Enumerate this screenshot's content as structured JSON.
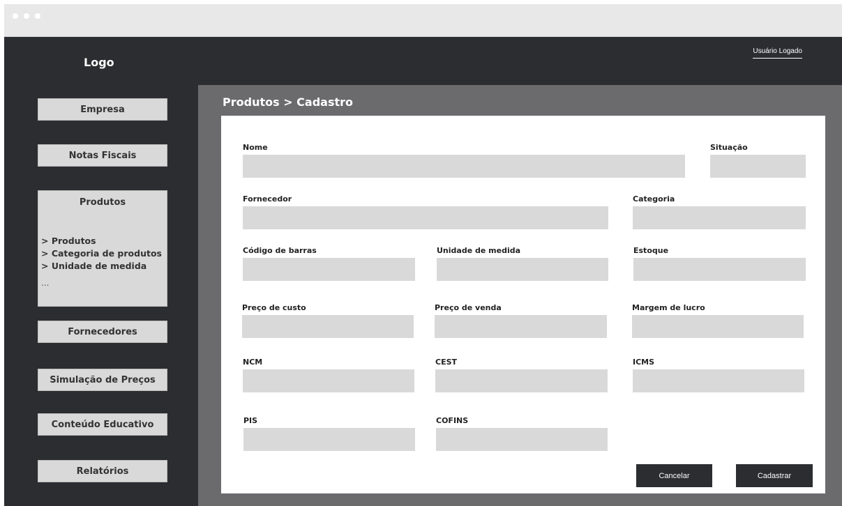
{
  "header": {
    "logo": "Logo",
    "user": "Usuário Logado"
  },
  "sidebar": {
    "empresa": "Empresa",
    "notas": "Notas Fiscais",
    "produtos": {
      "title": "Produtos",
      "items": [
        "> Produtos",
        "> Categoria de produtos",
        "> Unidade de medida"
      ],
      "more": "..."
    },
    "fornecedores": "Fornecedores",
    "simulacao": "Simulação de Preços",
    "conteudo": "Conteúdo Educativo",
    "relatorios": "Relatórios"
  },
  "page": {
    "title": "Produtos > Cadastro"
  },
  "form": {
    "nome": "Nome",
    "situacao": "Situação",
    "fornecedor": "Fornecedor",
    "categoria": "Categoria",
    "codigo_barras": "Código de barras",
    "unidade_medida": "Unidade de medida",
    "estoque": "Estoque",
    "preco_custo": "Preço de custo",
    "preco_venda": "Preço de venda",
    "margem_lucro": "Margem de lucro",
    "ncm": "NCM",
    "cest": "CEST",
    "icms": "ICMS",
    "pis": "PIS",
    "cofins": "COFINS"
  },
  "actions": {
    "cancel": "Cancelar",
    "submit": "Cadastrar"
  },
  "colors": {
    "dark": "#2c2d31",
    "content_bg": "#6b6b6e",
    "field": "#d9d9d9"
  }
}
